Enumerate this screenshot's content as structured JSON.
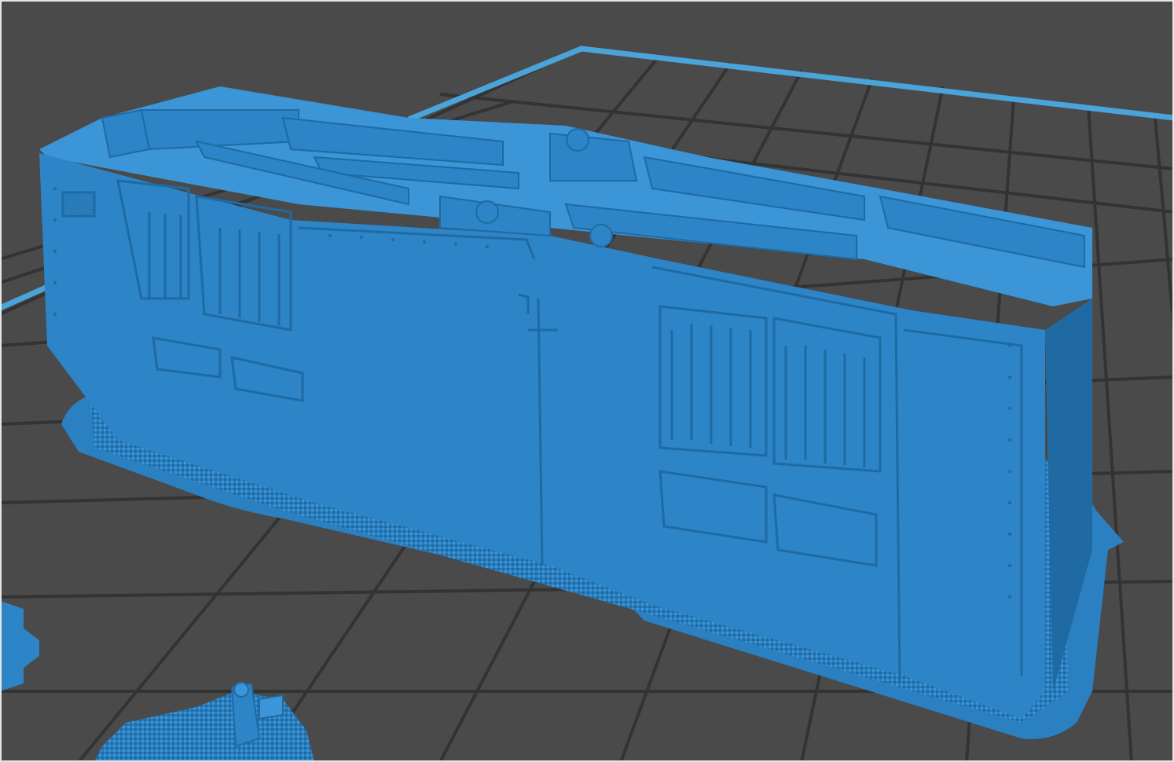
{
  "viewport": {
    "background": "#4a4a4a",
    "grid_color": "#333333",
    "bed_edge_color": "#4aa3d9",
    "model_color": "#2d84c6",
    "model_highlight": "#3b95d6",
    "model_shadow": "#1f6aa3",
    "support_color": "#2a7dbd",
    "raft_color": "#2b80c2"
  },
  "objects": [
    {
      "name": "main-building-model",
      "selected": false
    },
    {
      "name": "left-edge-model-fragment",
      "selected": false
    },
    {
      "name": "bottom-turret-model",
      "selected": false
    }
  ]
}
